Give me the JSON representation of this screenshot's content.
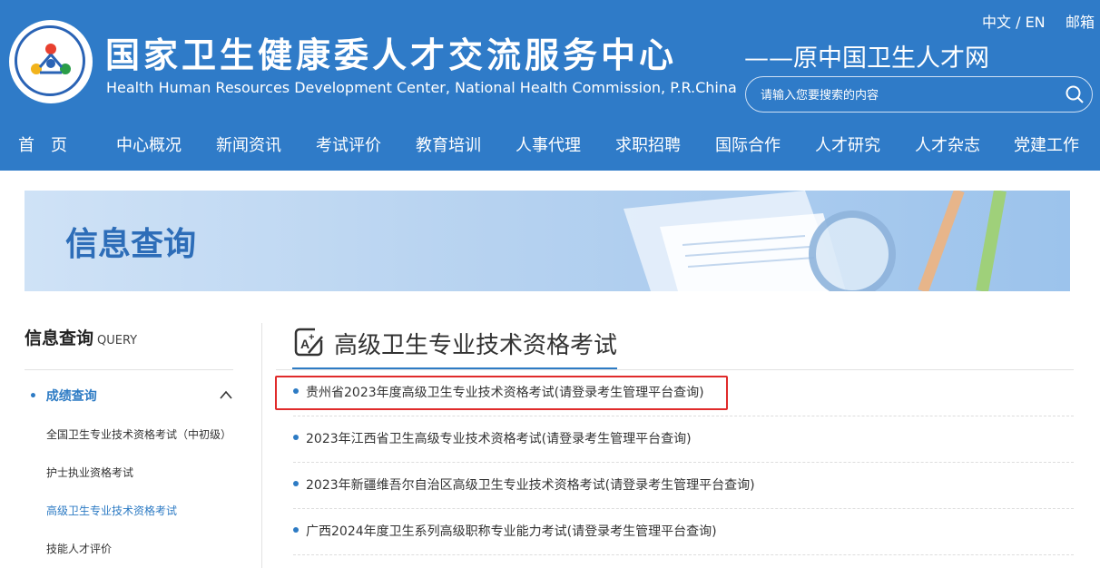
{
  "header": {
    "title": "国家卫生健康委人才交流服务中心",
    "subtitle": "Health Human Resources Development Center, National Health Commission, P.R.China",
    "slogan": "——原中国卫生人才网",
    "lang": "中文 / EN",
    "mail": "邮箱",
    "search_placeholder": "请输入您要搜索的内容"
  },
  "nav": [
    {
      "label": "首　页"
    },
    {
      "label": "中心概况"
    },
    {
      "label": "新闻资讯"
    },
    {
      "label": "考试评价"
    },
    {
      "label": "教育培训"
    },
    {
      "label": "人事代理"
    },
    {
      "label": "求职招聘"
    },
    {
      "label": "国际合作"
    },
    {
      "label": "人才研究"
    },
    {
      "label": "人才杂志"
    },
    {
      "label": "党建工作"
    }
  ],
  "banner": {
    "title": "信息查询"
  },
  "sidebar": {
    "title": "信息查询",
    "title_en": "QUERY",
    "section": "成绩查询",
    "items": [
      {
        "label": "全国卫生专业技术资格考试（中初级）"
      },
      {
        "label": "护士执业资格考试"
      },
      {
        "label": "高级卫生专业技术资格考试"
      },
      {
        "label": "技能人才评价"
      }
    ]
  },
  "main": {
    "title": "高级卫生专业技术资格考试",
    "items": [
      {
        "text": "贵州省2023年度高级卫生专业技术资格考试(请登录考生管理平台查询)"
      },
      {
        "text": "2023年江西省卫生高级专业技术资格考试(请登录考生管理平台查询)"
      },
      {
        "text": "2023年新疆维吾尔自治区高级卫生专业技术资格考试(请登录考生管理平台查询)"
      },
      {
        "text": "广西2024年度卫生系列高级职称专业能力考试(请登录考生管理平台查询)"
      }
    ]
  },
  "colors": {
    "header_bg": "#2f7bc8",
    "accent": "#2d7bc4",
    "highlight_border": "#e02b2b"
  }
}
